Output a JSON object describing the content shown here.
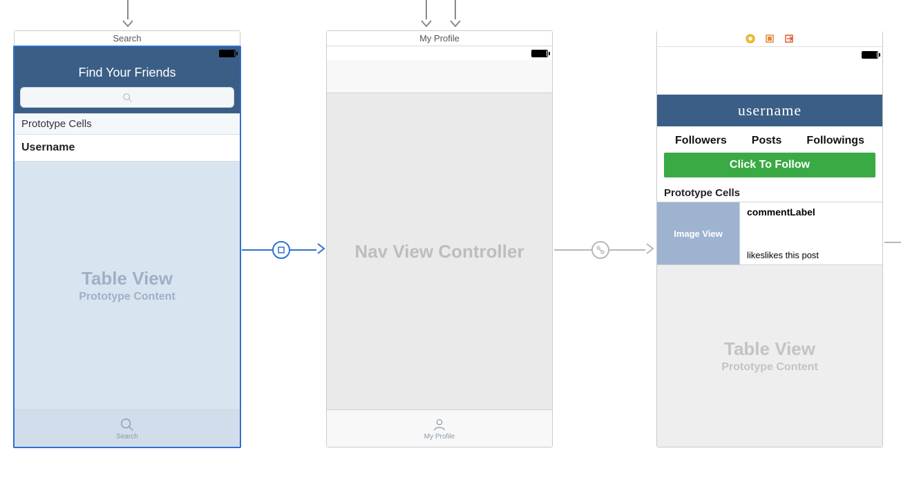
{
  "scene1": {
    "title": "Search",
    "nav_title": "Find Your Friends",
    "section_header": "Prototype Cells",
    "cell_label": "Username",
    "table_big": "Table View",
    "table_small": "Prototype Content",
    "tab_label": "Search"
  },
  "scene2": {
    "title": "My Profile",
    "body": "Nav View Controller",
    "tab_label": "My Profile"
  },
  "scene3": {
    "nav_title": "username",
    "stat_followers": "Followers",
    "stat_posts": "Posts",
    "stat_followings": "Followings",
    "follow_btn": "Click To Follow",
    "proto_label": "Prototype Cells",
    "image_view": "Image View",
    "comment_label": "commentLabel",
    "likes_label": "likeslikes this post",
    "table_big": "Table View",
    "table_small": "Prototype Content"
  }
}
